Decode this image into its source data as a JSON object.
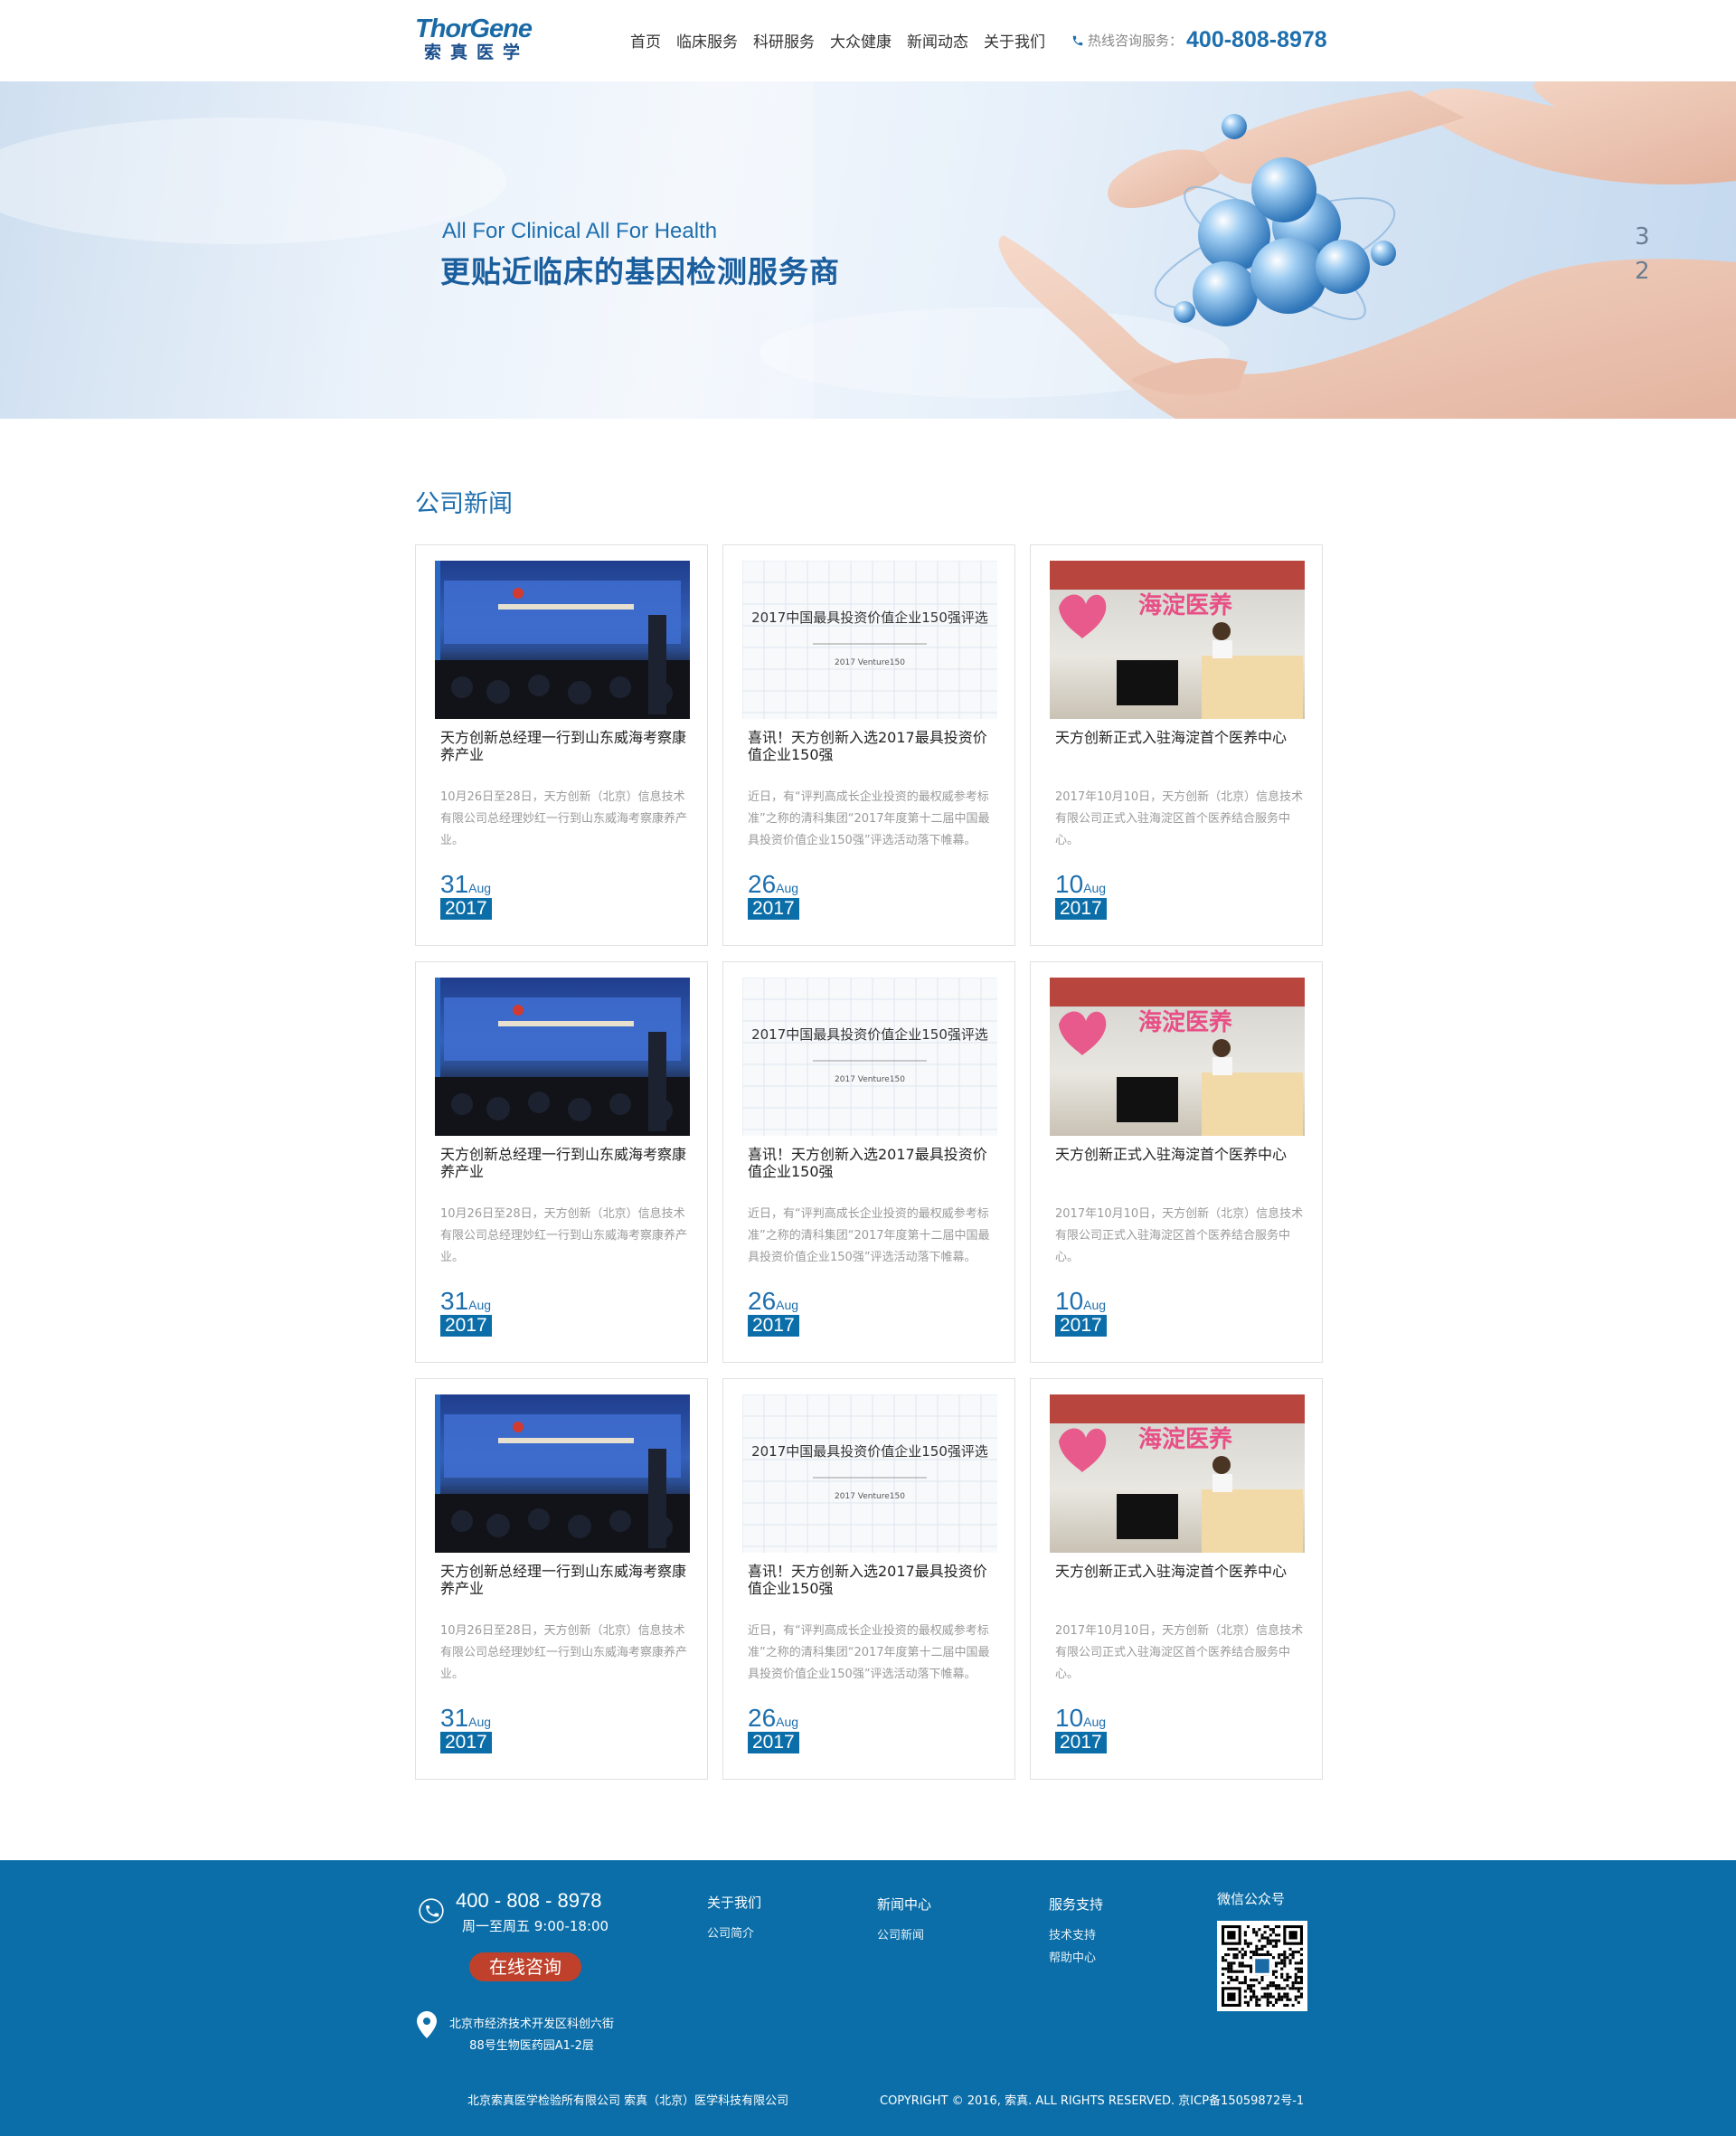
{
  "header": {
    "logo_en": "ThorGene",
    "logo_cn": "索真医学",
    "nav": [
      "首页",
      "临床服务",
      "科研服务",
      "大众健康",
      "新闻动态",
      "关于我们"
    ],
    "hotline_label": "热线咨询服务：",
    "hotline_number": "400-808-8978"
  },
  "banner": {
    "subtitle": "All For Clinical All For Health",
    "title": "更贴近临床的基因检测服务商"
  },
  "news": {
    "section_title": "公司新闻",
    "cards": [
      {
        "title": "天方创新总经理一行到山东威海考察康养产业",
        "summary": "10月26日至28日，天方创新（北京）信息技术有限公司总经理妙红一行到山东威海考察康养产业。",
        "day": "31",
        "month": "Aug",
        "year": "2017",
        "image": "conference-photo"
      },
      {
        "title": "喜讯！天方创新入选2017最具投资价值企业150强",
        "summary": "近日，有“评判高成长企业投资的最权威参考标准”之称的清科集团“2017年度第十二届中国最具投资价值企业150强”评选活动落下帷幕。",
        "day": "26",
        "month": "Aug",
        "year": "2017",
        "image": "venture-award-graphic",
        "image_text": "2017中国最具投资价值企业150强评选",
        "image_sub": "2017 Venture150"
      },
      {
        "title": "天方创新正式入驻海淀首个医养中心",
        "summary": "2017年10月10日，天方创新（北京）信息技术有限公司正式入驻海淀区首个医养结合服务中心。",
        "day": "10",
        "month": "Aug",
        "year": "2017",
        "image": "reception-desk-photo",
        "image_text": "海淀医养"
      },
      {
        "title": "天方创新总经理一行到山东威海考察康养产业",
        "summary": "10月26日至28日，天方创新（北京）信息技术有限公司总经理妙红一行到山东威海考察康养产业。",
        "day": "31",
        "month": "Aug",
        "year": "2017",
        "image": "conference-photo"
      },
      {
        "title": "喜讯！天方创新入选2017最具投资价值企业150强",
        "summary": "近日，有“评判高成长企业投资的最权威参考标准”之称的清科集团“2017年度第十二届中国最具投资价值企业150强”评选活动落下帷幕。",
        "day": "26",
        "month": "Aug",
        "year": "2017",
        "image": "venture-award-graphic",
        "image_text": "2017中国最具投资价值企业150强评选",
        "image_sub": "2017 Venture150"
      },
      {
        "title": "天方创新正式入驻海淀首个医养中心",
        "summary": "2017年10月10日，天方创新（北京）信息技术有限公司正式入驻海淀区首个医养结合服务中心。",
        "day": "10",
        "month": "Aug",
        "year": "2017",
        "image": "reception-desk-photo",
        "image_text": "海淀医养"
      },
      {
        "title": "天方创新总经理一行到山东威海考察康养产业",
        "summary": "10月26日至28日，天方创新（北京）信息技术有限公司总经理妙红一行到山东威海考察康养产业。",
        "day": "31",
        "month": "Aug",
        "year": "2017",
        "image": "conference-photo"
      },
      {
        "title": "喜讯！天方创新入选2017最具投资价值企业150强",
        "summary": "近日，有“评判高成长企业投资的最权威参考标准”之称的清科集团“2017年度第十二届中国最具投资价值企业150强”评选活动落下帷幕。",
        "day": "26",
        "month": "Aug",
        "year": "2017",
        "image": "venture-award-graphic",
        "image_text": "2017中国最具投资价值企业150强评选",
        "image_sub": "2017 Venture150"
      },
      {
        "title": "天方创新正式入驻海淀首个医养中心",
        "summary": "2017年10月10日，天方创新（北京）信息技术有限公司正式入驻海淀区首个医养结合服务中心。",
        "day": "10",
        "month": "Aug",
        "year": "2017",
        "image": "reception-desk-photo",
        "image_text": "海淀医养"
      }
    ]
  },
  "footer": {
    "phone": "400 - 808 - 8978",
    "hours": "周一至周五 9:00-18:00",
    "consult_button": "在线咨询",
    "address_line1": "北京市经济技术开发区科创六街",
    "address_line2": "88号生物医药园A1-2层",
    "columns": [
      {
        "title": "关于我们",
        "links": [
          "公司简介"
        ]
      },
      {
        "title": "新闻中心",
        "links": [
          "公司新闻"
        ]
      },
      {
        "title": "服务支持",
        "links": [
          "技术支持",
          "帮助中心"
        ]
      }
    ],
    "wechat_title": "微信公众号",
    "copyright_left": "北京索真医学检验所有限公司   索真（北京）医学科技有限公司",
    "copyright_right": "COPYRIGHT © 2016, 索真. ALL RIGHTS RESERVED. 京ICP备15059872号-1"
  },
  "colors": {
    "brand_blue": "#1e6fae",
    "footer_blue": "#0b6ea8",
    "consult_red": "#c0412b"
  }
}
